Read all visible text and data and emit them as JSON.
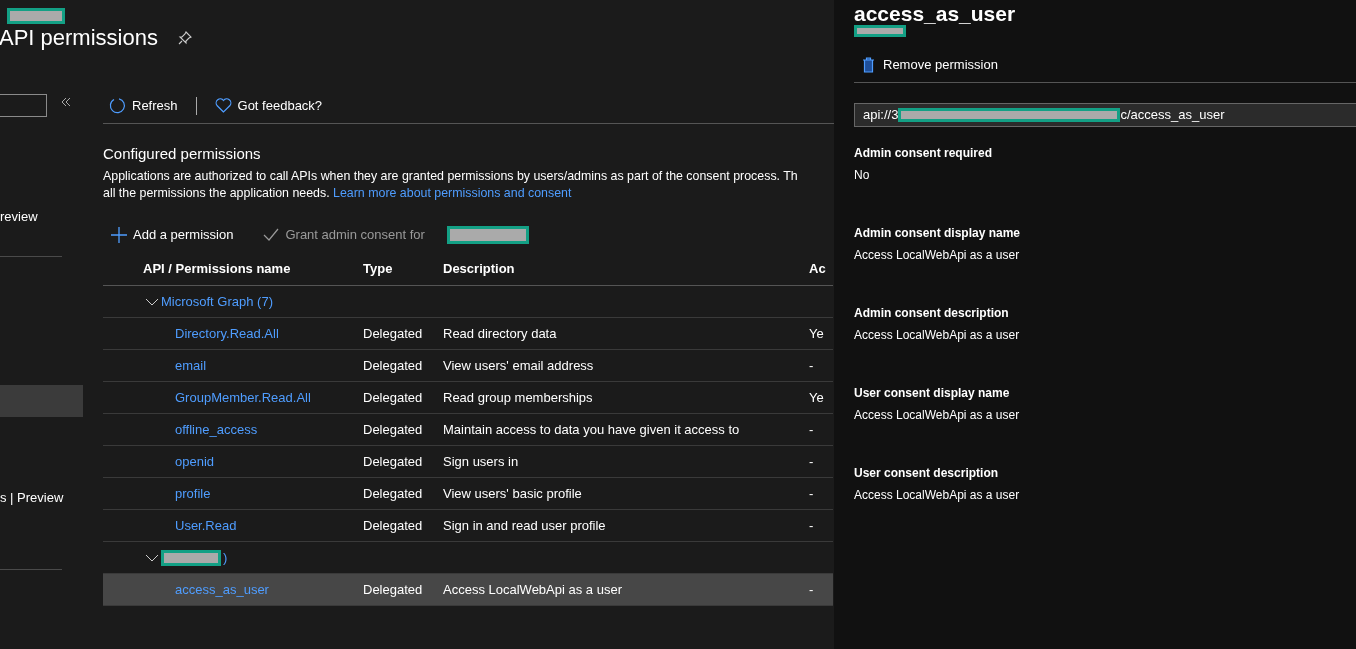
{
  "page": {
    "redacted_header": true,
    "title": "API permissions"
  },
  "sidebar": {
    "items": [
      {
        "label": "review",
        "selected": false
      },
      {
        "selected": true
      },
      {
        "label": "s | Preview",
        "selected": false
      }
    ]
  },
  "toolbar": [
    {
      "kind": "refresh",
      "label": "Refresh"
    },
    {
      "kind": "feedback",
      "label": "Got feedback?"
    }
  ],
  "section": {
    "title": "Configured permissions",
    "text": "Applications are authorized to call APIs when they are granted permissions by users/admins as part of the consent process. Th",
    "text_2": "all the permissions the application needs.",
    "link": "Learn more about permissions and consent"
  },
  "actions": [
    {
      "kind": "add",
      "label": "Add a permission",
      "disabled": false
    },
    {
      "kind": "grant",
      "label": "Grant admin consent for",
      "disabled": true
    }
  ],
  "table": {
    "columns": [
      "API / Permissions name",
      "Type",
      "Description",
      "Ac"
    ],
    "groups": [
      {
        "name": "Microsoft Graph (7)",
        "redacted": false,
        "expanded": true,
        "rows": [
          {
            "name": "Directory.Read.All",
            "type": "Delegated",
            "description": "Read directory data",
            "column_4": "Ye",
            "selected": false
          },
          {
            "name": "email",
            "type": "Delegated",
            "description": "View users' email address",
            "column_4": "-",
            "selected": false
          },
          {
            "name": "GroupMember.Read.All",
            "type": "Delegated",
            "description": "Read group memberships",
            "column_4": "Ye",
            "selected": false
          },
          {
            "name": "offline_access",
            "type": "Delegated",
            "description": "Maintain access to data you have given it access to",
            "column_4": "-",
            "selected": false
          },
          {
            "name": "openid",
            "type": "Delegated",
            "description": "Sign users in",
            "column_4": "-",
            "selected": false
          },
          {
            "name": "profile",
            "type": "Delegated",
            "description": "View users' basic profile",
            "column_4": "-",
            "selected": false
          },
          {
            "name": "User.Read",
            "type": "Delegated",
            "description": "Sign in and read user profile",
            "column_4": "-",
            "selected": false
          }
        ]
      },
      {
        "name": ")",
        "redacted": true,
        "expanded": true,
        "rows": [
          {
            "name": "access_as_user",
            "type": "Delegated",
            "description": "Access LocalWebApi as a user",
            "column_4": "-",
            "selected": true
          }
        ]
      }
    ]
  },
  "panel": {
    "title": "access_as_user",
    "redacted_subtitle": true,
    "action": "Remove permission",
    "field": {
      "value_start": "api://3",
      "value_end": "c/access_as_user"
    },
    "properties": [
      {
        "label": "Admin consent required",
        "value": "No"
      },
      {
        "label": "Admin consent display name",
        "value": "Access LocalWebApi as a user"
      },
      {
        "label": "Admin consent description",
        "value": "Access LocalWebApi as a user"
      },
      {
        "label": "User consent display name",
        "value": "Access LocalWebApi as a user"
      },
      {
        "label": "User consent description",
        "value": "Access LocalWebApi as a user"
      }
    ]
  }
}
